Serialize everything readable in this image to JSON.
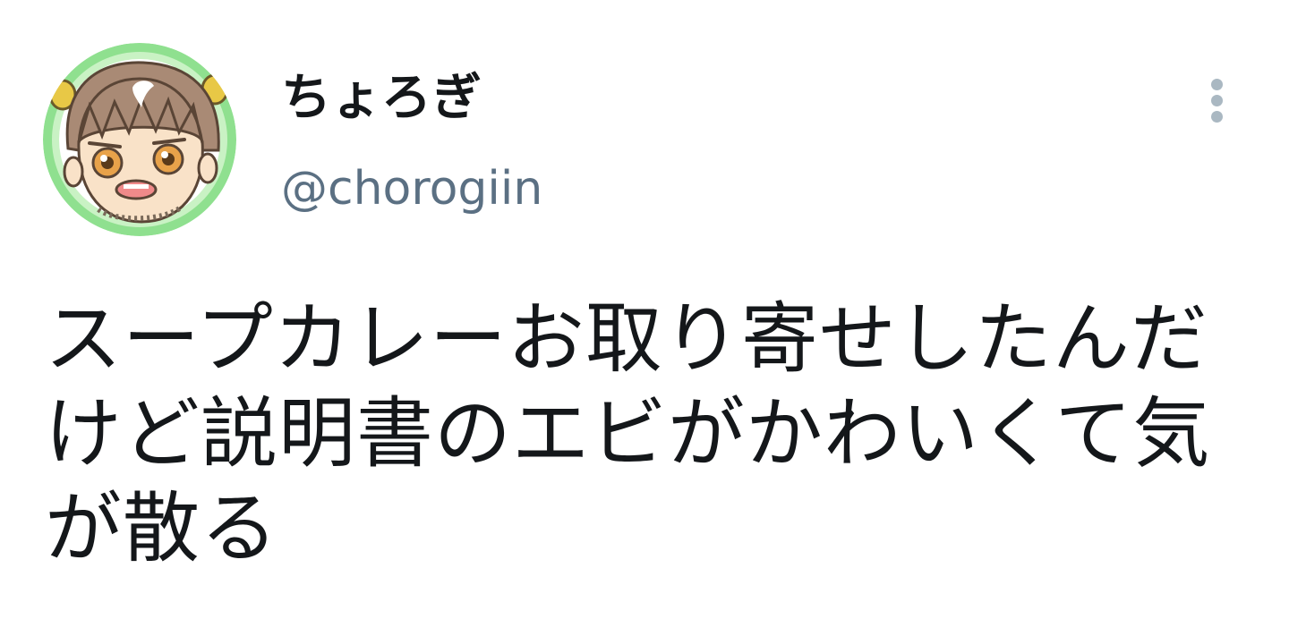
{
  "user": {
    "display_name": "ちょろぎ",
    "handle": "@chorogiin"
  },
  "tweet": {
    "text": "スープカレーお取り寄せしたんだけど説明書のエビがかわいくて気が散る"
  },
  "icons": {
    "avatar": "avatar-illustration",
    "more": "more-vertical-icon"
  },
  "colors": {
    "name": "#14171a",
    "handle": "#5b7083",
    "more_icon": "#aab8c2",
    "avatar_ring": "#7fdc7f"
  }
}
